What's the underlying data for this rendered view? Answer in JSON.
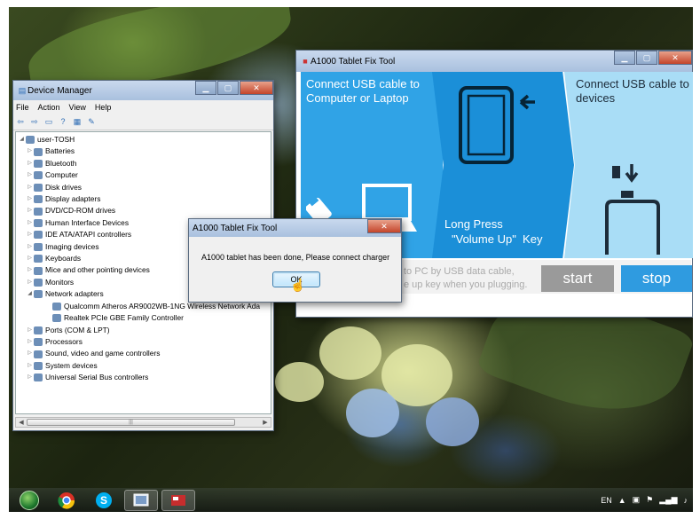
{
  "device_manager": {
    "title": "Device Manager",
    "menu": [
      "File",
      "Action",
      "View",
      "Help"
    ],
    "toolbar_icons": [
      "back-icon",
      "forward-icon",
      "properties-icon",
      "help-icon",
      "view-icon",
      "scan-icon"
    ],
    "tree": [
      {
        "label": "user-TOSH",
        "level": 0,
        "expanded": true
      },
      {
        "label": "Batteries",
        "level": 1
      },
      {
        "label": "Bluetooth",
        "level": 1
      },
      {
        "label": "Computer",
        "level": 1
      },
      {
        "label": "Disk drives",
        "level": 1
      },
      {
        "label": "Display adapters",
        "level": 1
      },
      {
        "label": "DVD/CD-ROM drives",
        "level": 1
      },
      {
        "label": "Human Interface Devices",
        "level": 1
      },
      {
        "label": "IDE ATA/ATAPI controllers",
        "level": 1
      },
      {
        "label": "Imaging devices",
        "level": 1
      },
      {
        "label": "Keyboards",
        "level": 1
      },
      {
        "label": "Mice and other pointing devices",
        "level": 1
      },
      {
        "label": "Monitors",
        "level": 1
      },
      {
        "label": "Network adapters",
        "level": 1,
        "expanded": true
      },
      {
        "label": "Qualcomm Atheros AR9002WB-1NG Wireless Network Ada",
        "level": 2
      },
      {
        "label": "Realtek PCIe GBE Family Controller",
        "level": 2
      },
      {
        "label": "Ports (COM & LPT)",
        "level": 1
      },
      {
        "label": "Processors",
        "level": 1
      },
      {
        "label": "Sound, video and game controllers",
        "level": 1
      },
      {
        "label": "System devices",
        "level": 1
      },
      {
        "label": "Universal Serial Bus controllers",
        "level": 1
      }
    ]
  },
  "tool": {
    "title": "A1000 Tablet Fix Tool",
    "panel1_text": "Connect USB cable to Computer or Laptop",
    "panel2_line1": "Long Press",
    "panel2_line2": "\"Volume Up\"  Key",
    "panel3_text": "Connect USB cable to devices",
    "footer_line1": "to PC by USB data cable,",
    "footer_line2": "e up key when you plugging.",
    "start_label": "start",
    "stop_label": "stop",
    "colors": {
      "panel1": "#30a3e6",
      "panel2": "#1b8fd8",
      "panel3": "#a9ddf6",
      "stop": "#2f9be0",
      "start": "#9a9a9a"
    }
  },
  "dialog": {
    "title": "A1000 Tablet Fix Tool",
    "message": "A1000 tablet has been done, Please connect charger",
    "ok_label": "OK"
  },
  "taskbar": {
    "items": [
      "start-orb",
      "chrome-icon",
      "skype-icon",
      "device-manager-icon",
      "fix-tool-icon"
    ],
    "language": "EN"
  }
}
